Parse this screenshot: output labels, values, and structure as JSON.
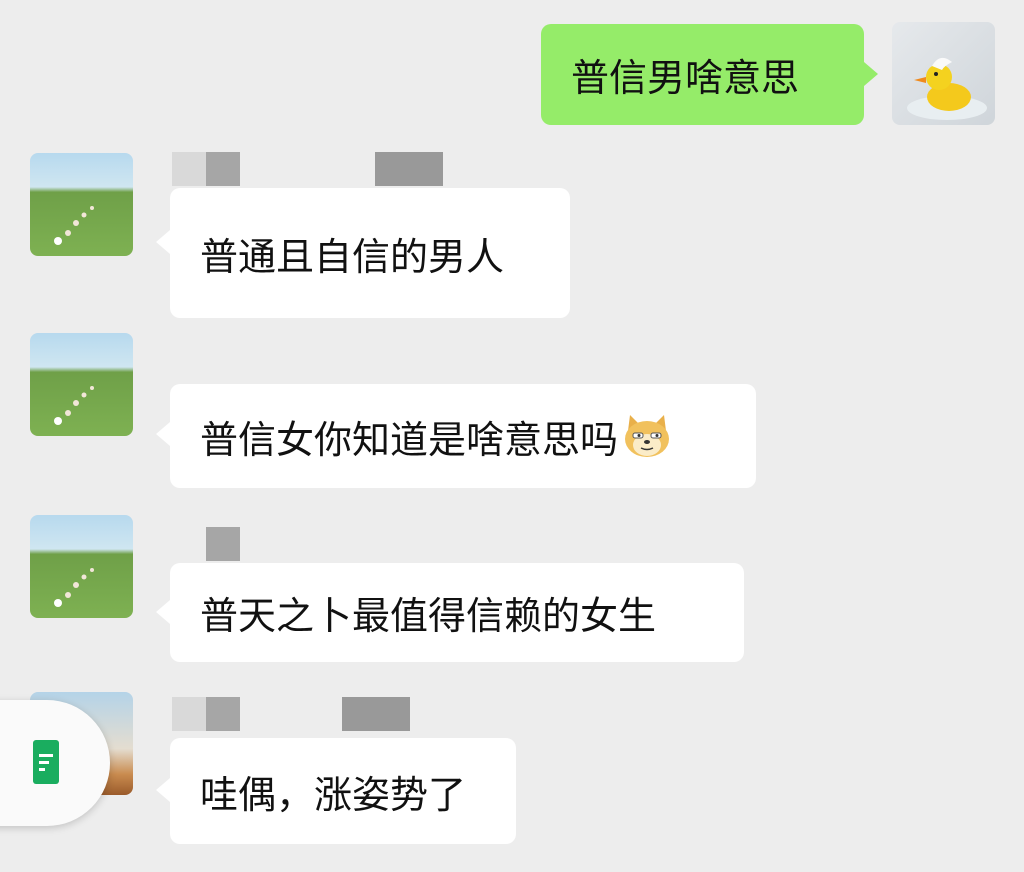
{
  "messages": [
    {
      "side": "right",
      "text": "普信男啥意思",
      "avatar_icon": "duck-avatar-icon"
    },
    {
      "side": "left",
      "text": "普通且自信的男人",
      "avatar_icon": "grass-field-avatar-icon"
    },
    {
      "side": "left",
      "text": "普信女你知道是啥意思吗",
      "emoji": "doge-emoji-icon",
      "avatar_icon": "grass-field-avatar-icon"
    },
    {
      "side": "left",
      "text": "普天之卜最值得信赖的女生",
      "avatar_icon": "grass-field-avatar-icon"
    },
    {
      "side": "left",
      "text": "哇偶，涨姿势了",
      "avatar_icon": "beach-avatar-icon"
    }
  ],
  "floating_button": {
    "icon": "document-icon"
  },
  "colors": {
    "background": "#ededed",
    "sent_bubble": "#95ec69",
    "received_bubble": "#ffffff",
    "doc_icon": "#1aad5f"
  }
}
